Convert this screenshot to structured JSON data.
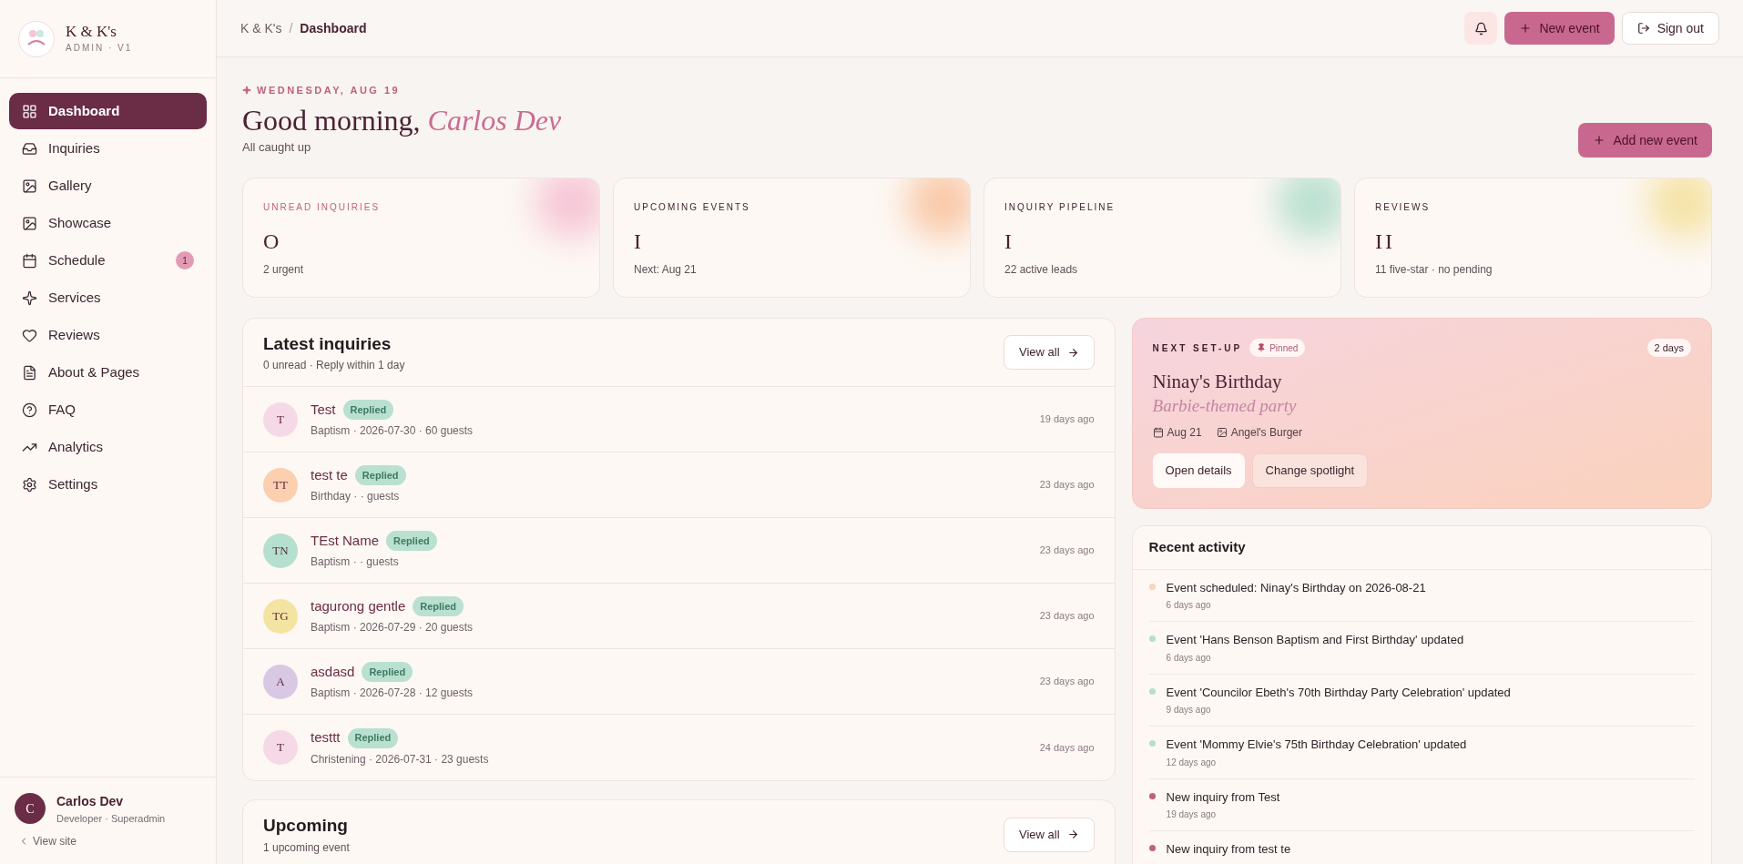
{
  "brand": {
    "name": "K & K's",
    "subtitle": "ADMIN · V1"
  },
  "nav": [
    {
      "label": "Dashboard",
      "selected": true
    },
    {
      "label": "Inquiries",
      "selected": false
    },
    {
      "label": "Gallery",
      "selected": false
    },
    {
      "label": "Showcase",
      "selected": false
    },
    {
      "label": "Schedule",
      "selected": false,
      "badge": "1"
    },
    {
      "label": "Services",
      "selected": false
    },
    {
      "label": "Reviews",
      "selected": false
    },
    {
      "label": "About & Pages",
      "selected": false
    },
    {
      "label": "FAQ",
      "selected": false
    },
    {
      "label": "Analytics",
      "selected": false
    },
    {
      "label": "Settings",
      "selected": false
    }
  ],
  "user": {
    "initial": "C",
    "name": "Carlos Dev",
    "role": "Developer · Superadmin",
    "view_site": "View site"
  },
  "breadcrumb": [
    "K & K's",
    "/",
    "Dashboard"
  ],
  "header_buttons": {
    "new_event": "New event",
    "sign_out": "Sign out"
  },
  "greeting": {
    "date": "WEDNESDAY, AUG 19",
    "text": "Good morning,",
    "name": "Carlos Dev",
    "subtitle": "All caught up",
    "add_button": "Add new event"
  },
  "stats": [
    {
      "label": "UNREAD INQUIRIES",
      "value": "O",
      "note": "2 urgent",
      "color": "#f6c6d6"
    },
    {
      "label": "UPCOMING EVENTS",
      "value": "I",
      "note": "Next: Aug 21",
      "color": "#f9c9a8"
    },
    {
      "label": "INQUIRY PIPELINE",
      "value": "I",
      "note": "22 active leads",
      "color": "#b9e0d0"
    },
    {
      "label": "REVIEWS",
      "value": "II",
      "note": "11 five-star · no pending",
      "color": "#f5e3a6"
    }
  ],
  "inquiries": {
    "title": "Latest inquiries",
    "subtitle": "0 unread · Reply within 1 day",
    "view_all": "View all",
    "rows": [
      {
        "initials": "T",
        "name": "Test",
        "status": "Replied",
        "details": "Baptism · 2026-07-30 · 60 guests",
        "time": "19 days ago",
        "color": "#f6d9e6"
      },
      {
        "initials": "TT",
        "name": "test te",
        "status": "Replied",
        "details": "Birthday · · guests",
        "time": "23 days ago",
        "color": "#fbcfb0"
      },
      {
        "initials": "TN",
        "name": "TEst Name",
        "status": "Replied",
        "details": "Baptism · · guests",
        "time": "23 days ago",
        "color": "#b5dfcf"
      },
      {
        "initials": "TG",
        "name": "tagurong gentle",
        "status": "Replied",
        "details": "Baptism · 2026-07-29 · 20 guests",
        "time": "23 days ago",
        "color": "#f4e4a2"
      },
      {
        "initials": "A",
        "name": "asdasd",
        "status": "Replied",
        "details": "Baptism · 2026-07-28 · 12 guests",
        "time": "23 days ago",
        "color": "#d9c8e4"
      },
      {
        "initials": "T",
        "name": "testtt",
        "status": "Replied",
        "details": "Christening · 2026-07-31 · 23 guests",
        "time": "24 days ago",
        "color": "#f6d9e6"
      }
    ]
  },
  "upcoming": {
    "title": "Upcoming",
    "subtitle": "1 upcoming event",
    "view_all": "View all"
  },
  "spotlight": {
    "label": "NEXT SET-UP",
    "pinned": "Pinned",
    "countdown": "2 days",
    "title": "Ninay's Birthday",
    "subtitle": "Barbie-themed party",
    "date": "Aug 21",
    "venue": "Angel's Burger",
    "buttons": [
      "Open details",
      "Change spotlight"
    ]
  },
  "activity": {
    "title": "Recent activity",
    "items": [
      {
        "text": "Event scheduled: Ninay's Birthday on 2026-08-21",
        "time": "6 days ago",
        "color": "#fbd3b8"
      },
      {
        "text": "Event 'Hans Benson Baptism and First Birthday' updated",
        "time": "6 days ago",
        "color": "#b5dfcf"
      },
      {
        "text": "Event 'Councilor Ebeth's 70th Birthday Party Celebration' updated",
        "time": "9 days ago",
        "color": "#b5dfcf"
      },
      {
        "text": "Event 'Mommy Elvie's 75th Birthday Celebration' updated",
        "time": "12 days ago",
        "color": "#b5dfcf"
      },
      {
        "text": "New inquiry from Test",
        "time": "19 days ago",
        "color": "#c0607f"
      },
      {
        "text": "New inquiry from test te",
        "color": "#c0607f"
      }
    ]
  }
}
